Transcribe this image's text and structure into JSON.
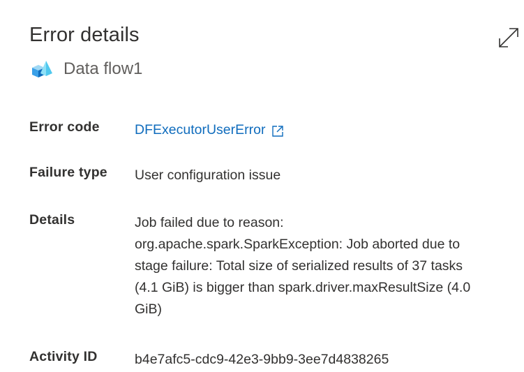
{
  "header": {
    "title": "Error details",
    "subtitle": "Data flow1",
    "expand_icon": "expand-icon",
    "dataflow_icon": "data-flow-icon"
  },
  "fields": {
    "error_code": {
      "label": "Error code",
      "value": "DFExecutorUserError",
      "icon": "external-link-icon"
    },
    "failure_type": {
      "label": "Failure type",
      "value": "User configuration issue"
    },
    "details": {
      "label": "Details",
      "value": "Job failed due to reason:\norg.apache.spark.SparkException: Job aborted due to\nstage failure: Total size of serialized results of 37 tasks\n(4.1 GiB) is bigger than spark.driver.maxResultSize (4.0\nGiB)"
    },
    "activity_id": {
      "label": "Activity ID",
      "value": "b4e7afc5-cdc9-42e3-9bb9-3ee7d4838265"
    }
  },
  "colors": {
    "link": "#0f6cbd",
    "text": "#323130",
    "subtle_text": "#605e5c"
  }
}
